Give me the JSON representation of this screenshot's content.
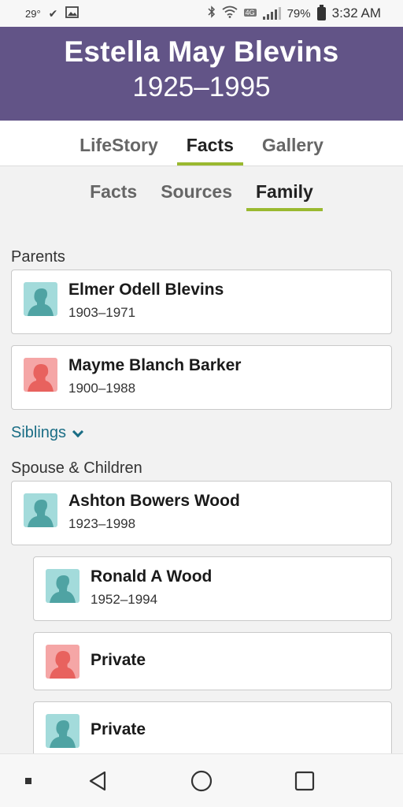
{
  "status_bar": {
    "temperature": "29°",
    "battery_pct": "79%",
    "time": "3:32 AM",
    "network": "4G"
  },
  "header": {
    "name": "Estella May Blevins",
    "dates": "1925–1995",
    "bg_color": "#625487"
  },
  "main_tabs": [
    {
      "label": "LifeStory",
      "active": false
    },
    {
      "label": "Facts",
      "active": true
    },
    {
      "label": "Gallery",
      "active": false
    }
  ],
  "sub_tabs": [
    {
      "label": "Facts",
      "active": false
    },
    {
      "label": "Sources",
      "active": false
    },
    {
      "label": "Family",
      "active": true
    }
  ],
  "accent_color": "#9ab930",
  "parents": {
    "label": "Parents",
    "people": [
      {
        "name": "Elmer Odell Blevins",
        "dates": "1903–1971",
        "gender": "male",
        "icon": "male-silhouette-icon"
      },
      {
        "name": "Mayme Blanch Barker",
        "dates": "1900–1988",
        "gender": "female",
        "icon": "female-silhouette-icon"
      }
    ]
  },
  "siblings": {
    "label": "Siblings",
    "icon": "chevron-down-icon"
  },
  "spouse_children": {
    "label": "Spouse & Children",
    "spouse": {
      "name": "Ashton Bowers Wood",
      "dates": "1923–1998",
      "gender": "male",
      "icon": "male-silhouette-icon"
    },
    "children": [
      {
        "name": "Ronald A Wood",
        "dates": "1952–1994",
        "gender": "male",
        "icon": "male-silhouette-icon"
      },
      {
        "name": "Private",
        "dates": "",
        "gender": "female",
        "icon": "female-silhouette-icon"
      },
      {
        "name": "Private",
        "dates": "",
        "gender": "male",
        "icon": "male-silhouette-icon"
      }
    ]
  },
  "nav_bar": {
    "buttons": [
      "menu-dot-icon",
      "back-icon",
      "home-icon",
      "recents-icon"
    ]
  }
}
